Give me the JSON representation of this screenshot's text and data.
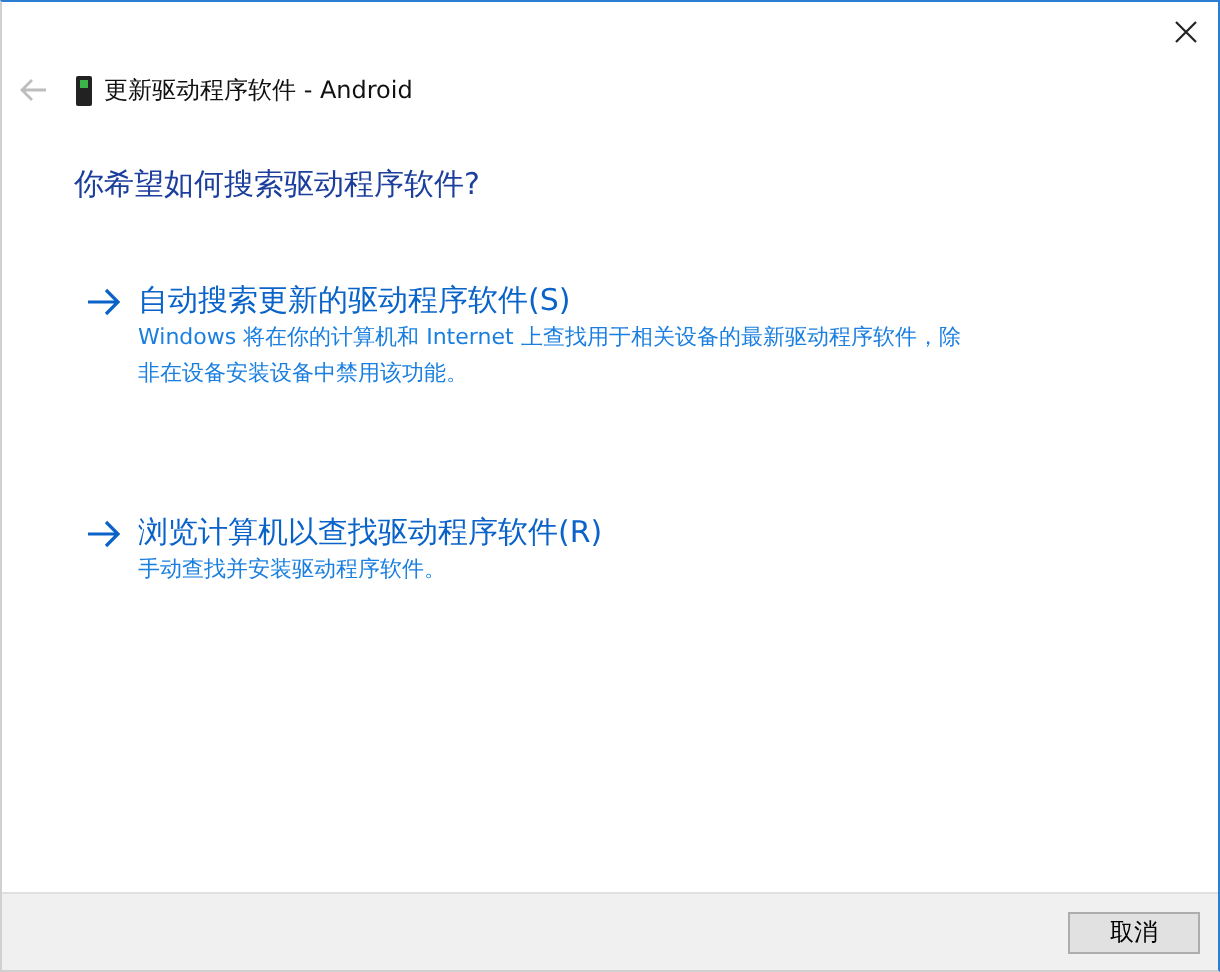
{
  "window": {
    "title": "更新驱动程序软件 - Android"
  },
  "back": {
    "disabled": true
  },
  "heading": "你希望如何搜索驱动程序软件?",
  "options": [
    {
      "title": "自动搜索更新的驱动程序软件(S)",
      "description": "Windows 将在你的计算机和 Internet 上查找用于相关设备的最新驱动程序软件，除非在设备安装设备中禁用该功能。"
    },
    {
      "title": "浏览计算机以查找驱动程序软件(R)",
      "description": "手动查找并安装驱动程序软件。"
    }
  ],
  "buttons": [
    "取消"
  ]
}
